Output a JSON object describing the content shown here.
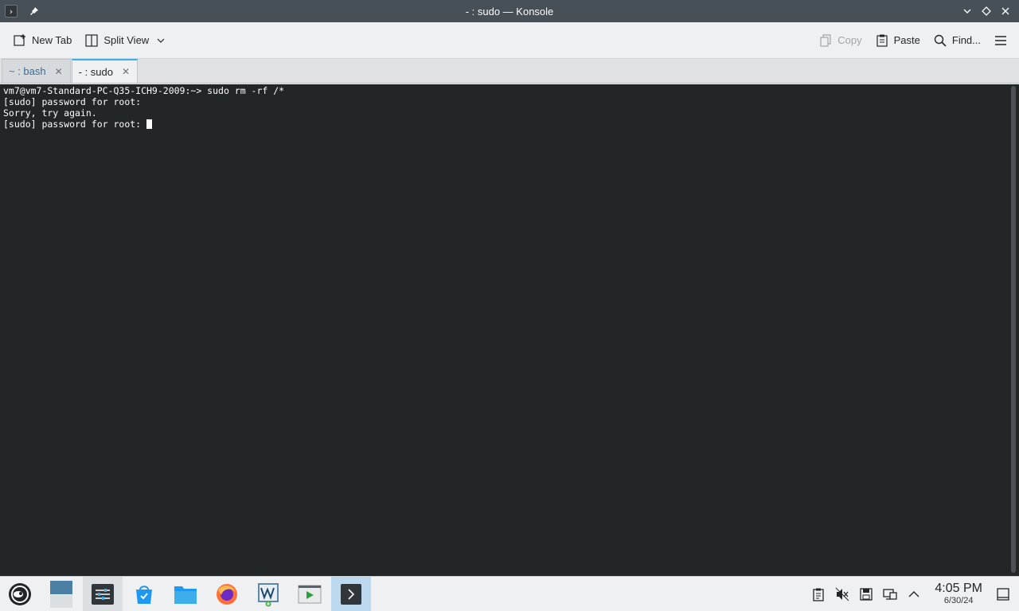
{
  "window": {
    "title": "- : sudo — Konsole"
  },
  "toolbar": {
    "new_tab_label": "New Tab",
    "split_view_label": "Split View",
    "copy_label": "Copy",
    "paste_label": "Paste",
    "find_label": "Find..."
  },
  "tabs": [
    {
      "label": "~ : bash",
      "active": false
    },
    {
      "label": "- : sudo",
      "active": true
    }
  ],
  "terminal": {
    "lines": [
      "vm7@vm7-Standard-PC-Q35-ICH9-2009:~> sudo rm -rf /*",
      "[sudo] password for root:",
      "Sorry, try again.",
      "[sudo] password for root: "
    ],
    "colors": {
      "background": "#232627",
      "foreground": "#fcfcfc"
    }
  },
  "taskbar": {
    "apps": [
      {
        "name": "application-launcher-icon"
      },
      {
        "name": "desktop-pager-icon"
      },
      {
        "name": "system-settings-icon"
      },
      {
        "name": "discover-store-icon"
      },
      {
        "name": "file-manager-icon"
      },
      {
        "name": "firefox-icon"
      },
      {
        "name": "virt-manager-icon"
      },
      {
        "name": "media-player-icon"
      },
      {
        "name": "konsole-icon"
      }
    ],
    "clock": {
      "time": "4:05 PM",
      "date": "6/30/24"
    }
  },
  "accent_color": "#3daee9"
}
